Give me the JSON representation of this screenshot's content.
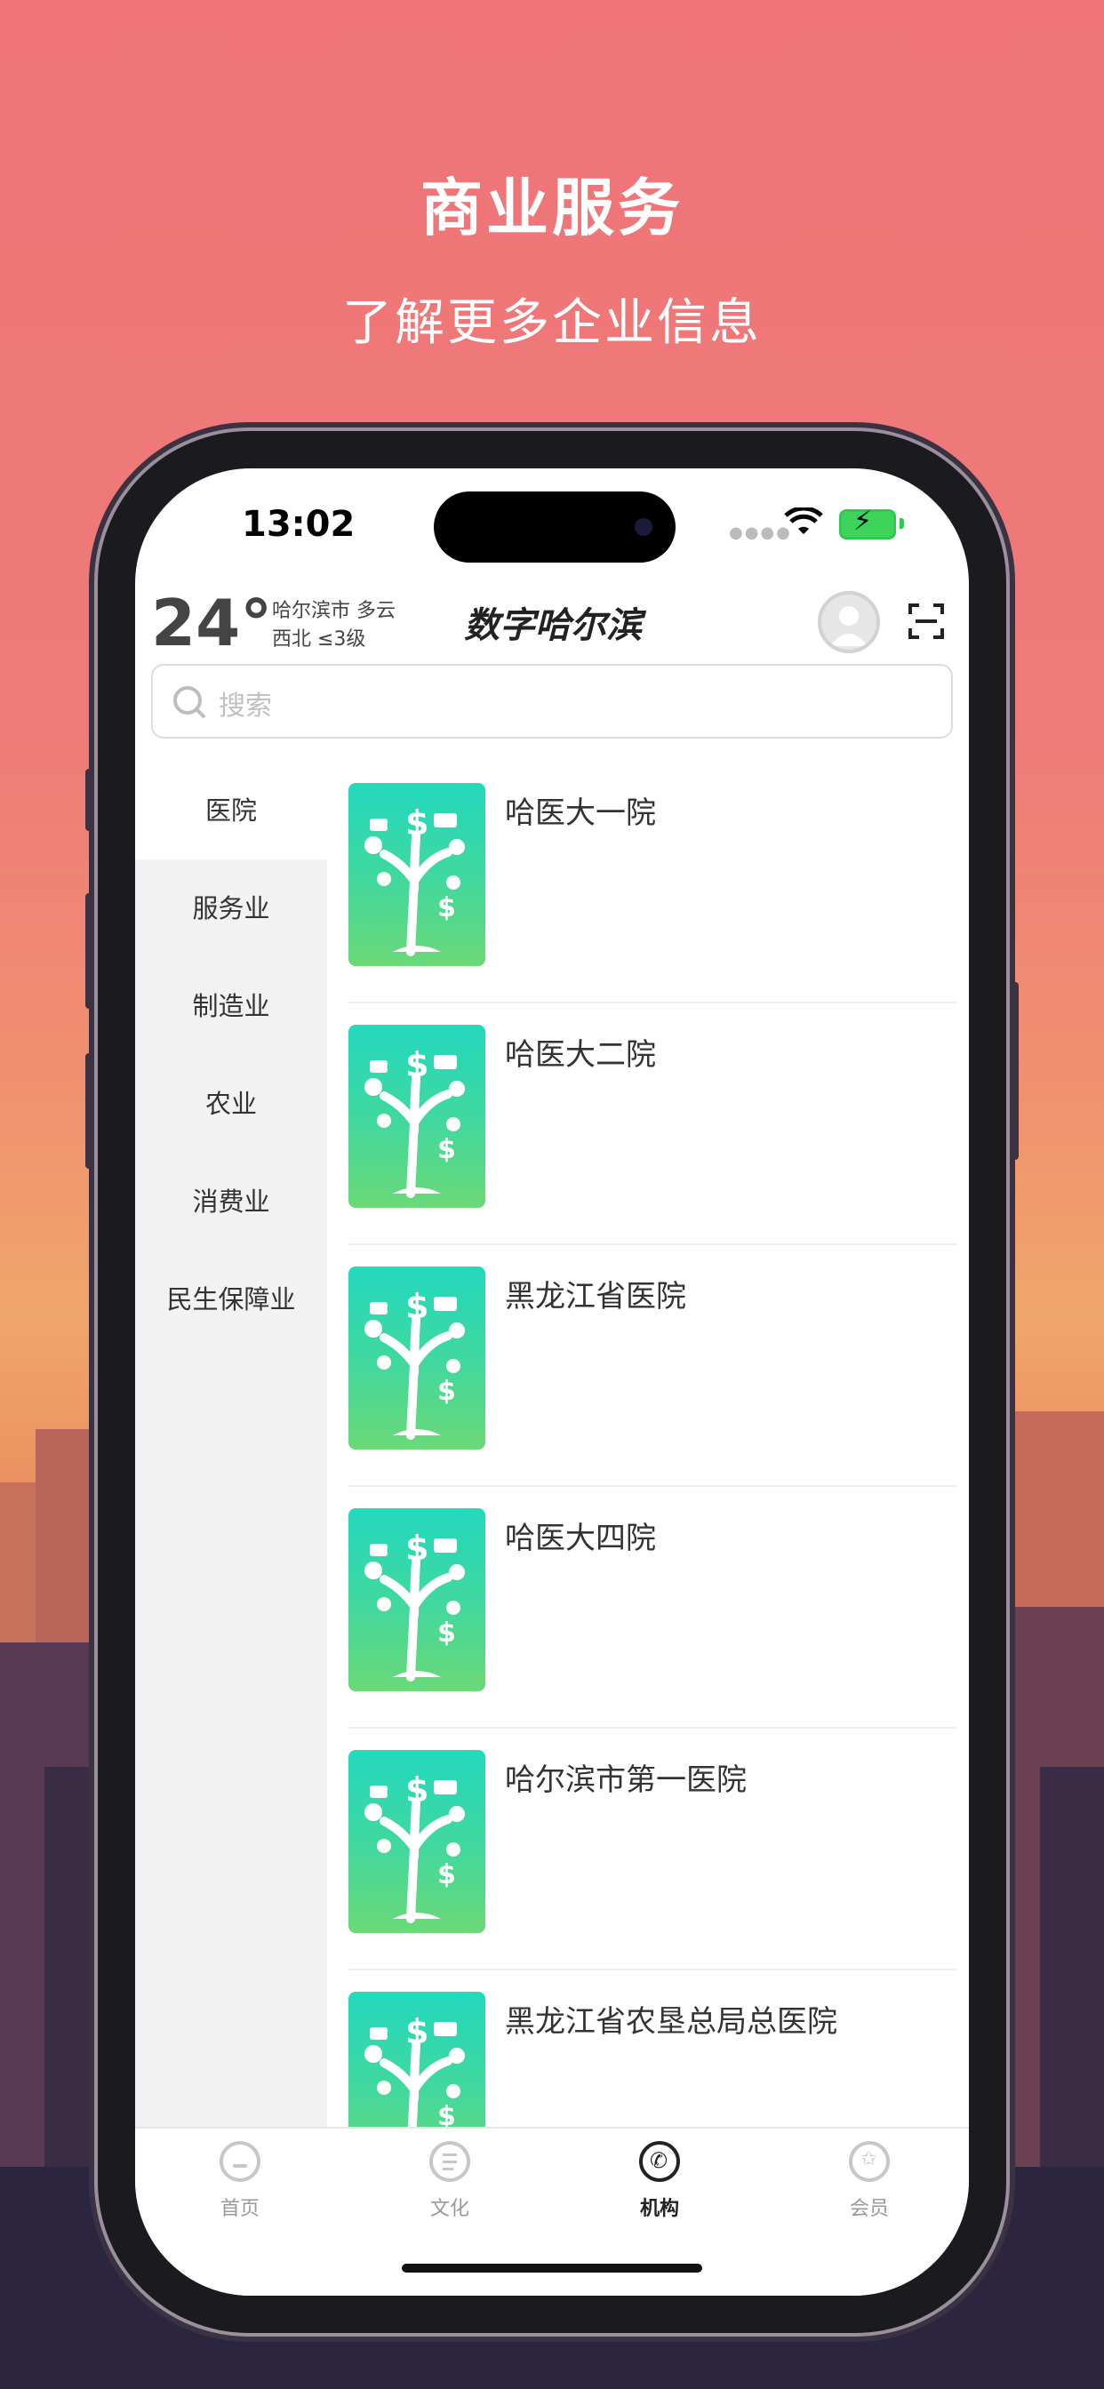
{
  "promo": {
    "title": "商业服务",
    "subtitle": "了解更多企业信息"
  },
  "status_bar": {
    "time": "13:02"
  },
  "header": {
    "temperature": "24°",
    "city_weather": "哈尔滨市 多云",
    "wind": "西北 ≤3级",
    "brand": "数字哈尔滨"
  },
  "search": {
    "placeholder": "搜索"
  },
  "sidebar": {
    "items": [
      {
        "label": "医院",
        "active": true
      },
      {
        "label": "服务业"
      },
      {
        "label": "制造业"
      },
      {
        "label": "农业"
      },
      {
        "label": "消费业"
      },
      {
        "label": "民生保障业"
      }
    ]
  },
  "list": {
    "items": [
      {
        "title": "哈医大一院"
      },
      {
        "title": "哈医大二院"
      },
      {
        "title": "黑龙江省医院"
      },
      {
        "title": "哈医大四院"
      },
      {
        "title": "哈尔滨市第一医院"
      },
      {
        "title": "黑龙江省农垦总局总医院"
      }
    ]
  },
  "tabbar": {
    "tabs": [
      {
        "label": "首页",
        "icon": "home-icon"
      },
      {
        "label": "文化",
        "icon": "document-icon"
      },
      {
        "label": "机构",
        "icon": "phone-icon",
        "active": true
      },
      {
        "label": "会员",
        "icon": "star-icon"
      }
    ]
  },
  "colors": {
    "background_top": "#ef7578",
    "thumb_top": "#23d8be",
    "thumb_bottom": "#6bd977",
    "battery": "#3ed35a"
  }
}
